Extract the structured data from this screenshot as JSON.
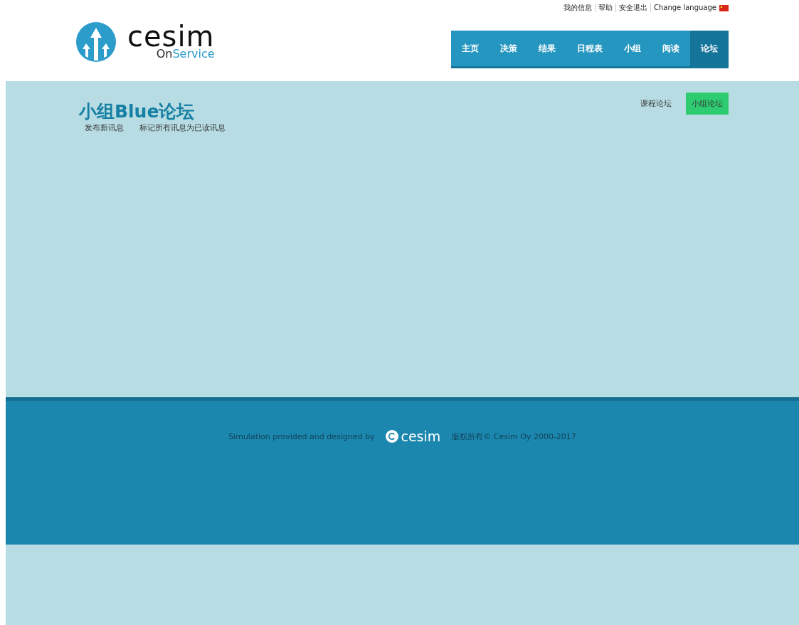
{
  "top_links": [
    {
      "label": "我的信息"
    },
    {
      "label": "帮助"
    },
    {
      "label": "安全退出"
    },
    {
      "label": "Change language"
    }
  ],
  "logo": {
    "word": "cesim",
    "sub_dark": "On",
    "sub_light": "Service"
  },
  "nav": [
    {
      "label": "主页",
      "selected": false
    },
    {
      "label": "决策",
      "selected": false
    },
    {
      "label": "结果",
      "selected": false
    },
    {
      "label": "日程表",
      "selected": false
    },
    {
      "label": "小组",
      "selected": false
    },
    {
      "label": "阅读",
      "selected": false
    },
    {
      "label": "论坛",
      "selected": true
    }
  ],
  "forum": {
    "title": "小组Blue论坛",
    "actions": [
      "发布新讯息",
      "标记所有讯息为已读讯息"
    ],
    "tabs": [
      {
        "label": "课程论坛",
        "selected": false
      },
      {
        "label": "小组论坛",
        "selected": true
      }
    ]
  },
  "footer": {
    "credit": "Simulation provided and designed by",
    "logo_word": "cesim",
    "copyright": "版权所有© Cesim Oy 2000-2017"
  }
}
